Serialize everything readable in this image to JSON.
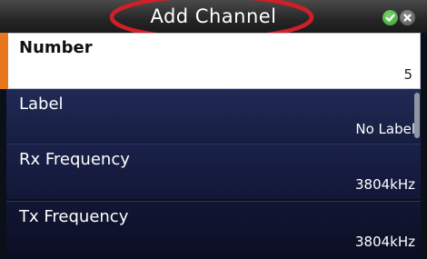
{
  "dialog": {
    "title": "Add Channel"
  },
  "fields": [
    {
      "label": "Number",
      "value": "5"
    },
    {
      "label": "Label",
      "value": "No Label"
    },
    {
      "label": "Rx Frequency",
      "value": "3804kHz"
    },
    {
      "label": "Tx Frequency",
      "value": "3804kHz"
    }
  ],
  "colors": {
    "accent": "#e8761c",
    "annotation": "#d11f2a",
    "confirm": "#4caf3f"
  },
  "icons": {
    "confirm": "check-icon",
    "cancel": "close-icon"
  }
}
